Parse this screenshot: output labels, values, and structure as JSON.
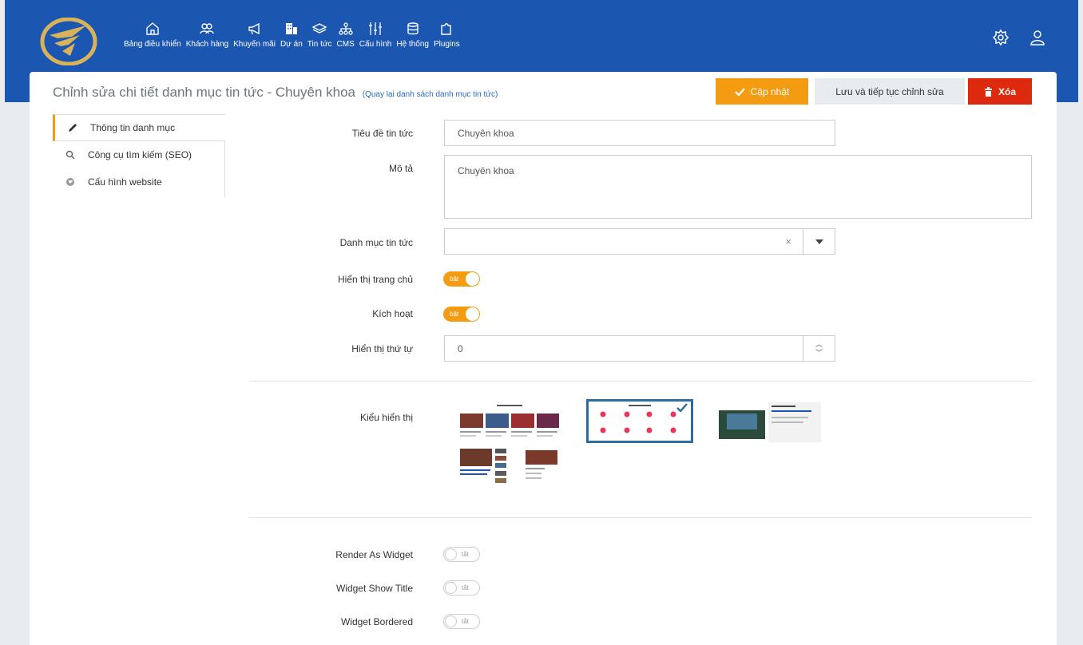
{
  "colors": {
    "topbar": "#1b56b1",
    "accent": "#f39c12",
    "danger": "#dd2a0e",
    "link": "#2a6ac8"
  },
  "nav": [
    {
      "label": "Bảng điều khiển",
      "icon": "home-icon"
    },
    {
      "label": "Khách hàng",
      "icon": "users-icon"
    },
    {
      "label": "Khuyến mãi",
      "icon": "megaphone-icon"
    },
    {
      "label": "Dự án",
      "icon": "building-icon"
    },
    {
      "label": "Tin tức",
      "icon": "layers-icon"
    },
    {
      "label": "CMS",
      "icon": "sitemap-icon"
    },
    {
      "label": "Cấu hình",
      "icon": "sliders-icon"
    },
    {
      "label": "Hệ thống",
      "icon": "database-icon"
    },
    {
      "label": "Plugins",
      "icon": "puzzle-icon"
    }
  ],
  "page": {
    "title": "Chỉnh sửa chi tiết danh mục tin tức - Chuyên khoa",
    "back_link": "(Quay lại danh sách danh mục tin tức)"
  },
  "actions": {
    "update": "Cập nhật",
    "save_continue": "Lưu và tiếp tục chỉnh sửa",
    "delete": "Xóa"
  },
  "tabs": [
    {
      "label": "Thông tin danh mục",
      "icon": "pencil-icon",
      "active": true
    },
    {
      "label": "Công cụ tìm kiếm (SEO)",
      "icon": "search-icon",
      "active": false
    },
    {
      "label": "Cấu hình website",
      "icon": "globe-icon",
      "active": false
    }
  ],
  "form": {
    "title_label": "Tiêu đề tin tức",
    "title_value": "Chuyên khoa",
    "desc_label": "Mô tả",
    "desc_value": "Chuyên khoa",
    "category_label": "Danh mục tin tức",
    "category_value": "",
    "category_clear": "×",
    "show_home_label": "Hiển thị trang chủ",
    "show_home_state": "bật",
    "active_label": "Kích hoạt",
    "active_state": "bật",
    "order_label": "Hiển thị thứ tự",
    "order_value": "0",
    "display_type_label": "Kiểu hiển thị",
    "display_type_selected": 2,
    "render_widget_label": "Render As Widget",
    "render_widget_state": "tắt",
    "widget_title_label": "Widget Show Title",
    "widget_title_state": "tắt",
    "widget_bordered_label": "Widget Bordered",
    "widget_bordered_state": "tắt"
  }
}
